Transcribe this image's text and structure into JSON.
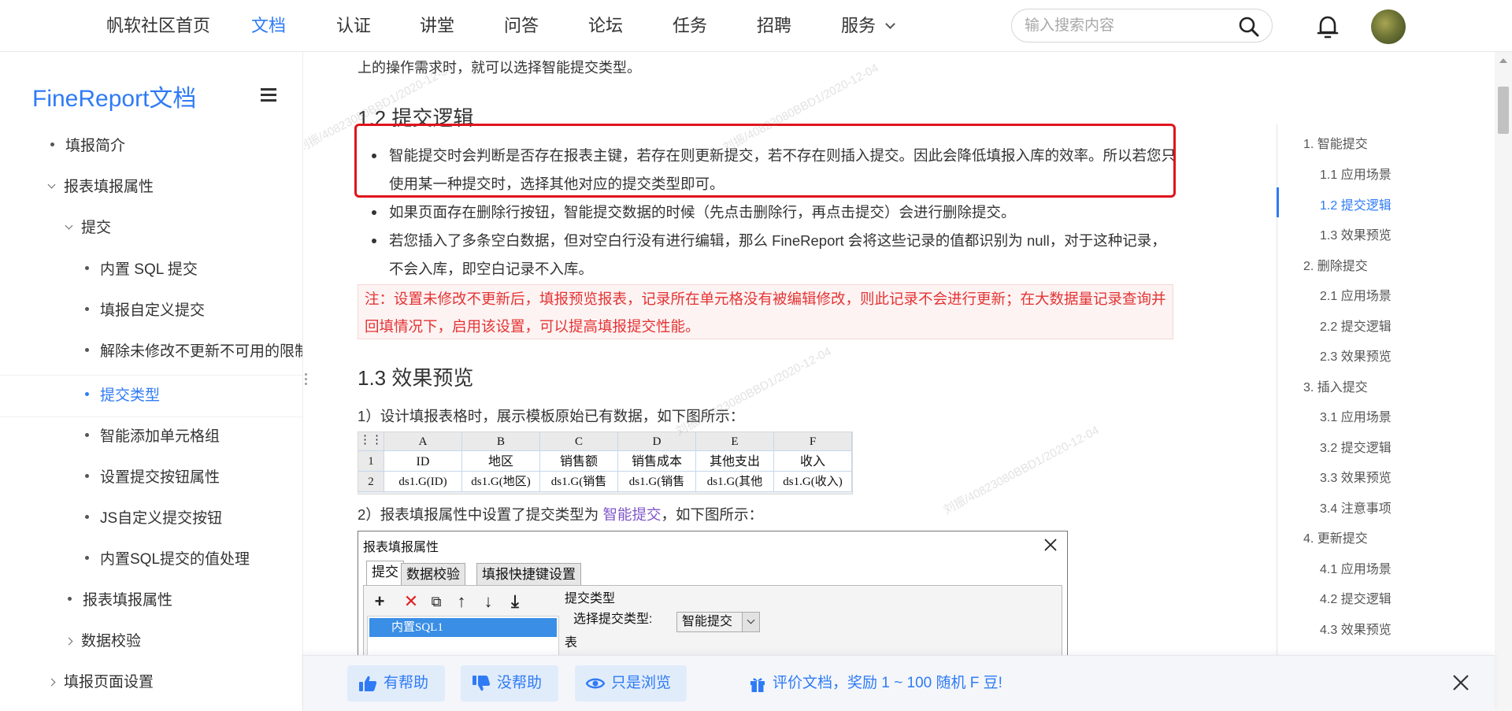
{
  "nav": {
    "items": [
      "帆软社区首页",
      "文档",
      "认证",
      "讲堂",
      "问答",
      "论坛",
      "任务",
      "招聘",
      "服务"
    ],
    "active_index": 1,
    "search_placeholder": "输入搜索内容"
  },
  "sidebar": {
    "logo": "FineReport文档",
    "items": [
      "填报简介",
      "报表填报属性",
      "提交",
      "内置 SQL 提交",
      "填报自定义提交",
      "解除未修改不更新不可用的限制",
      "提交类型",
      "智能添加单元格组",
      "设置提交按钮属性",
      "JS自定义提交按钮",
      "内置SQL提交的值处理",
      "报表填报属性",
      "数据校验",
      "填报页面设置"
    ],
    "active_index": 6
  },
  "main": {
    "intro": "上的操作需求时，就可以选择智能提交类型。",
    "section_12_title": "1.2 提交逻辑",
    "bullets": [
      "智能提交时会判断是否存在报表主键，若存在则更新提交，若不存在则插入提交。因此会降低填报入库的效率。所以若您只使用某一种提交时，选择其他对应的提交类型即可。",
      "如果页面存在删除行按钮，智能提交数据的时候（先点击删除行，再点击提交）会进行删除提交。",
      "若您插入了多条空白数据，但对空白行没有进行编辑，那么 FineReport 会将这些记录的值都识别为 null，对于这种记录，不会入库，即空白记录不入库。"
    ],
    "note": "注：设置未修改不更新后，填报预览报表，记录所在单元格没有被编辑修改，则此记录不会进行更新；在大数据量记录查询并回填情况下，启用该设置，可以提高填报提交性能。",
    "section_13_title": "1.3 效果预览",
    "step1": "1）设计填报表格时，展示模板原始已有数据，如下图所示：",
    "step2_prefix": "2）报表填报属性中设置了提交类型为 ",
    "step2_link": "智能提交",
    "step2_suffix": "，如下图所示：",
    "sheet": {
      "columns": [
        "A",
        "B",
        "C",
        "D",
        "E",
        "F"
      ],
      "row_numbers": [
        "1",
        "2"
      ],
      "row1": [
        "ID",
        "地区",
        "销售额",
        "销售成本",
        "其他支出",
        "收入"
      ],
      "row2": [
        "ds1.G(ID)",
        "ds1.G(地区)",
        "ds1.G(销售",
        "ds1.G(销售",
        "ds1.G(其他",
        "ds1.G(收入)"
      ]
    },
    "dialog": {
      "title": "报表填报属性",
      "tabs": [
        "提交",
        "数据校验",
        "填报快捷键设置"
      ],
      "list_item": "内置SQL1",
      "section_label": "提交类型",
      "select_label": "选择提交类型:",
      "select_value": "智能提交",
      "table_label": "表"
    }
  },
  "watermark": "刘振/40823080BBD1/2020-12-04",
  "toc": {
    "items": [
      "1. 智能提交",
      "1.1 应用场景",
      "1.2 提交逻辑",
      "1.3 效果预览",
      "2. 删除提交",
      "2.1 应用场景",
      "2.2 提交逻辑",
      "2.3 效果预览",
      "3. 插入提交",
      "3.1 应用场景",
      "3.2 提交逻辑",
      "3.3 效果预览",
      "3.4 注意事项",
      "4. 更新提交",
      "4.1 应用场景",
      "4.2 提交逻辑",
      "4.3 效果预览"
    ],
    "active_index": 2
  },
  "feedback": {
    "helpful": "有帮助",
    "not_helpful": "没帮助",
    "just_browsing": "只是浏览",
    "reward": "评价文档，奖励 1 ~ 100 随机 F 豆!"
  },
  "colors": {
    "accent": "#2f7bf5",
    "highlight_border": "#e0141c",
    "note_text": "#e53333",
    "link_purple": "#7f55c8"
  }
}
